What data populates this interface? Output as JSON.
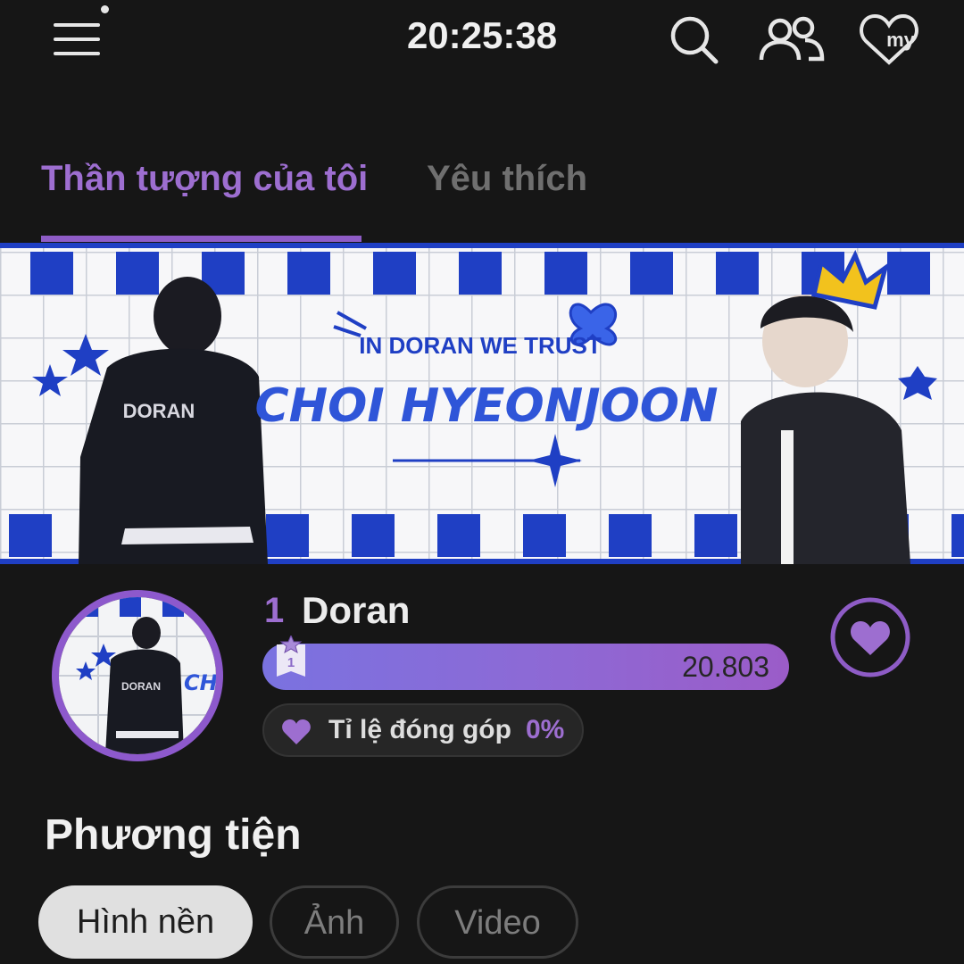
{
  "status": {
    "time": "20:25:38"
  },
  "header": {
    "icons": [
      "menu-icon",
      "search-icon",
      "friends-icon",
      "my-heart-icon"
    ],
    "my_label": "my"
  },
  "tabs": [
    {
      "label": "Thần tượng của tôi",
      "active": true
    },
    {
      "label": "Yêu thích",
      "active": false
    }
  ],
  "banner": {
    "tagline": "IN DORAN WE TRUST",
    "title": "CHOI HYEONJOON",
    "jersey_name": "DORAN"
  },
  "idol": {
    "rank": "1",
    "name": "Doran",
    "votes": "20.803",
    "badge_rank": "1",
    "avatar_jersey": "DORAN",
    "avatar_text": "CH"
  },
  "contribution": {
    "label": "Tỉ lệ đóng góp",
    "value": "0%"
  },
  "media": {
    "title": "Phương tiện",
    "chips": [
      {
        "label": "Hình nền",
        "active": true
      },
      {
        "label": "Ảnh",
        "active": false
      },
      {
        "label": "Video",
        "active": false
      }
    ]
  },
  "colors": {
    "accent": "#9d6ed0",
    "banner_blue": "#1f3fc4",
    "background": "#161616"
  }
}
